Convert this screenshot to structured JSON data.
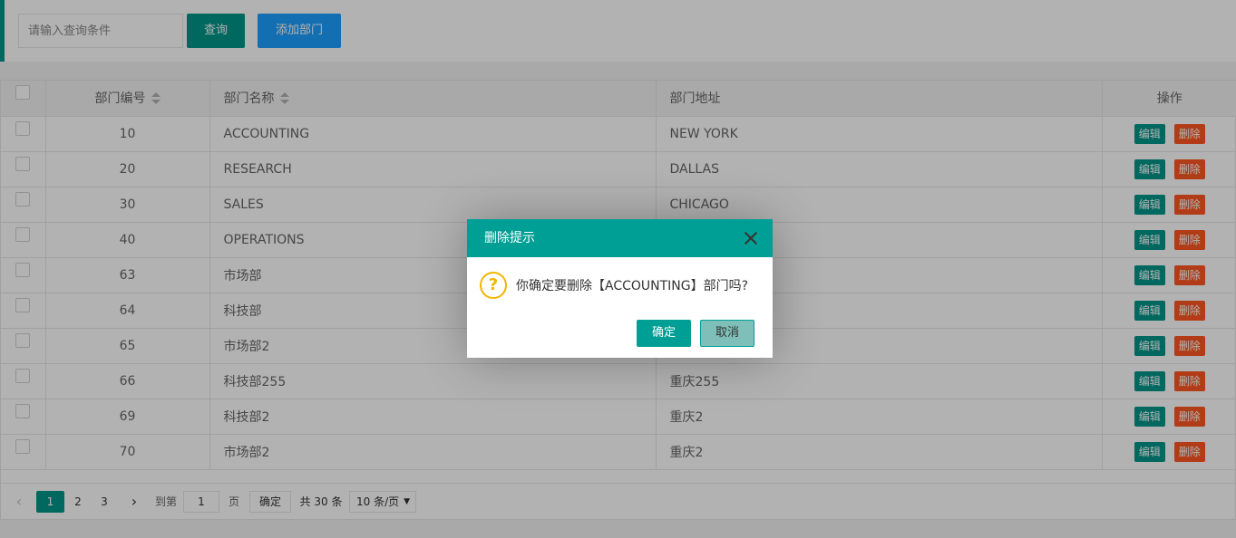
{
  "toolbar": {
    "search_placeholder": "请输入查询条件",
    "query_label": "查询",
    "add_label": "添加部门"
  },
  "table": {
    "headers": {
      "no": "部门编号",
      "name": "部门名称",
      "addr": "部门地址",
      "ops": "操作"
    },
    "edit_label": "编辑",
    "delete_label": "删除",
    "rows": [
      {
        "no": "10",
        "name": "ACCOUNTING",
        "addr": "NEW YORK"
      },
      {
        "no": "20",
        "name": "RESEARCH",
        "addr": "DALLAS"
      },
      {
        "no": "30",
        "name": "SALES",
        "addr": "CHICAGO"
      },
      {
        "no": "40",
        "name": "OPERATIONS",
        "addr": ""
      },
      {
        "no": "63",
        "name": "市场部",
        "addr": ""
      },
      {
        "no": "64",
        "name": "科技部",
        "addr": ""
      },
      {
        "no": "65",
        "name": "市场部2",
        "addr": ""
      },
      {
        "no": "66",
        "name": "科技部255",
        "addr": "重庆255"
      },
      {
        "no": "69",
        "name": "科技部2",
        "addr": "重庆2"
      },
      {
        "no": "70",
        "name": "市场部2",
        "addr": "重庆2"
      }
    ]
  },
  "pager": {
    "prev": "‹",
    "pages": [
      "1",
      "2",
      "3"
    ],
    "next": "›",
    "goto_label": "到第",
    "goto_value": "1",
    "page_label": "页",
    "ok_label": "确定",
    "total_label": "共 30 条",
    "size_label": "10 条/页",
    "size_arrow": "▼"
  },
  "dialog": {
    "title": "删除提示",
    "icon": "question-icon",
    "icon_glyph": "?",
    "message": "你确定要删除【ACCOUNTING】部门吗?",
    "ok_label": "确定",
    "cancel_label": "取消"
  },
  "colors": {
    "primary": "#009688",
    "blue": "#1E9FFF",
    "danger": "#FF5722",
    "warn": "#F0B600"
  }
}
